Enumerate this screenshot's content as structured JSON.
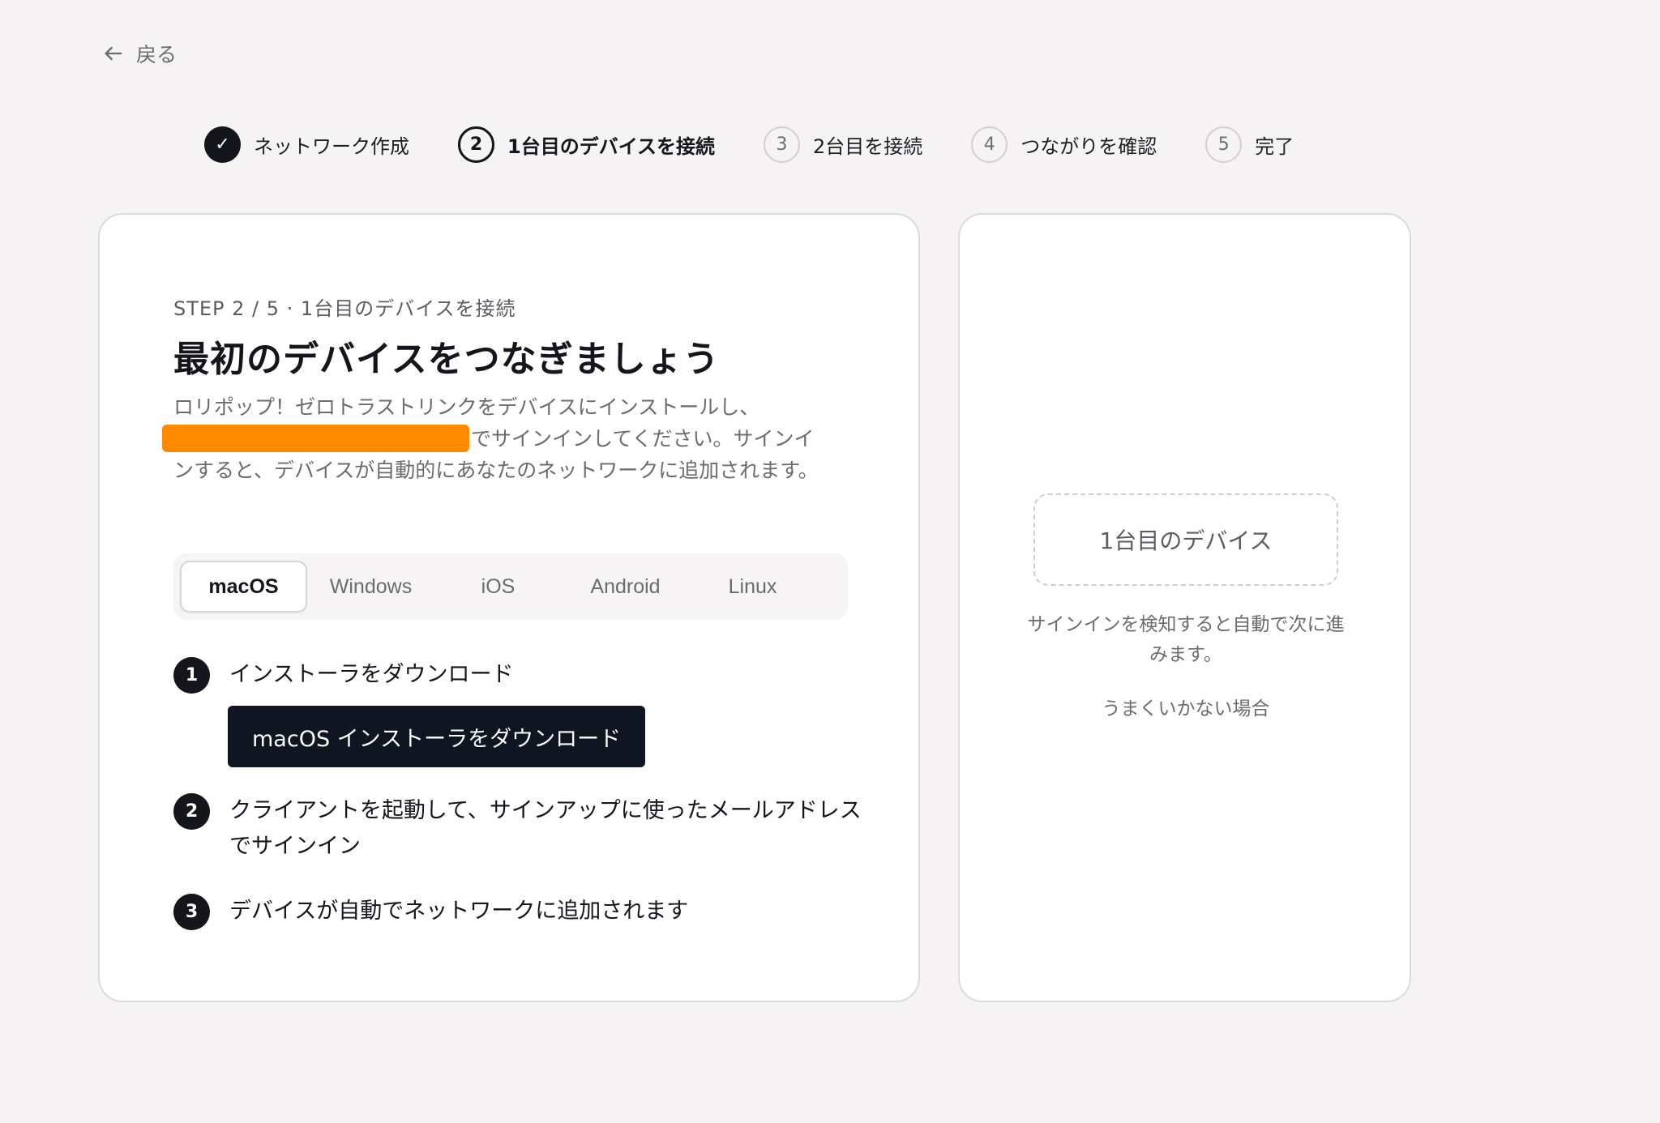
{
  "nav": {
    "back_label": "戻る"
  },
  "stepper": [
    {
      "index": "✓",
      "label": "ネットワーク作成",
      "state": "done"
    },
    {
      "index": "2",
      "label": "1台目のデバイスを接続",
      "state": "current"
    },
    {
      "index": "3",
      "label": "2台目を接続",
      "state": "todo"
    },
    {
      "index": "4",
      "label": "つながりを確認",
      "state": "todo"
    },
    {
      "index": "5",
      "label": "完了",
      "state": "todo"
    }
  ],
  "main": {
    "eyebrow": "STEP 2 / 5 · 1台目のデバイスを接続",
    "title": "最初のデバイスをつなぎましょう",
    "desc_part1": "ロリポップ！ゼロトラストリンクをデバイスにインストールし、",
    "desc_part2": "でサインインしてください。サインインすると、デバイスが自動的にあなたのネットワークに追加されます。",
    "os_tabs": [
      "macOS",
      "Windows",
      "iOS",
      "Android",
      "Linux"
    ],
    "selected_os": "macOS",
    "instructions": [
      {
        "num": "1",
        "text": "インストーラをダウンロード"
      },
      {
        "num": "2",
        "text": "クライアントを起動して、サインアップに使ったメールアドレスでサインイン"
      },
      {
        "num": "3",
        "text": "デバイスが自動でネットワークに追加されます"
      }
    ],
    "download_button": "macOS インストーラをダウンロード"
  },
  "side": {
    "device_slot_label": "1台目のデバイス",
    "note": "サインインを検知すると自動で次に進みます。",
    "help_link": "うまくいかない場合"
  },
  "colors": {
    "background": "#f5f3f3",
    "primary": "#14161c",
    "button": "#101522",
    "redaction": "#ff8a00"
  }
}
